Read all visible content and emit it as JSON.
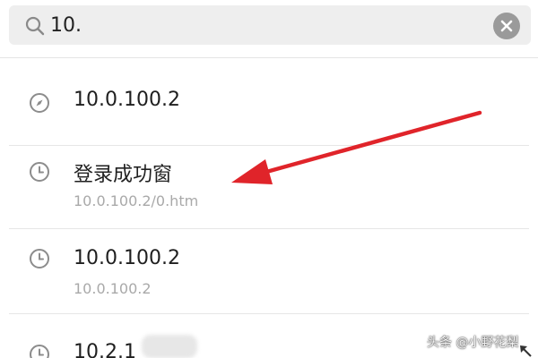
{
  "search": {
    "query": "10.",
    "clear_icon": "close-icon",
    "search_icon": "search-icon"
  },
  "suggestions": [
    {
      "icon": "compass-icon",
      "title": "10.0.100.2",
      "subtitle": ""
    },
    {
      "icon": "clock-icon",
      "title": "登录成功窗",
      "subtitle": "10.0.100.2/0.htm"
    },
    {
      "icon": "clock-icon",
      "title": "10.0.100.2",
      "subtitle": "10.0.100.2"
    },
    {
      "icon": "clock-icon",
      "title": "10.2.1",
      "subtitle": ""
    }
  ],
  "annotation": {
    "arrow_color": "#e0242a"
  },
  "watermark": {
    "text": "头条 @小野花梨"
  },
  "colors": {
    "search_bg": "#eeeeee",
    "clear_bg": "#9a9a9a",
    "subtitle": "#a9a9a9",
    "accent_arrow": "#e0242a"
  }
}
